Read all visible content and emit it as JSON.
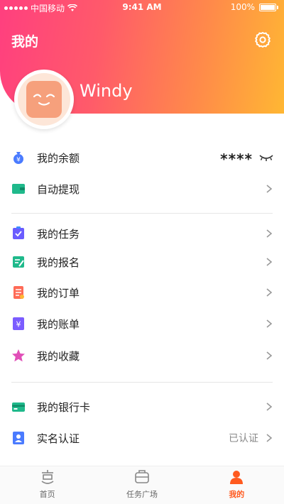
{
  "status_bar": {
    "carrier": "中国移动",
    "time": "9:41 AM",
    "battery": "100%"
  },
  "header": {
    "title": "我的",
    "settings_icon": "gear-icon",
    "gradient_colors": [
      "#ff3f7f",
      "#ff8a4a",
      "#ffb733"
    ]
  },
  "profile": {
    "username": "Windy"
  },
  "menu": {
    "balance": {
      "label": "我的余额",
      "value": "****",
      "icon": "money-bag-icon",
      "toggle_icon": "eye-closed-icon"
    },
    "auto_withdraw": {
      "label": "自动提现",
      "icon": "wallet-icon"
    },
    "tasks": {
      "label": "我的任务",
      "icon": "task-icon"
    },
    "signups": {
      "label": "我的报名",
      "icon": "signup-icon"
    },
    "orders": {
      "label": "我的订单",
      "icon": "order-icon"
    },
    "bills": {
      "label": "我的账单",
      "icon": "bill-icon"
    },
    "favorites": {
      "label": "我的收藏",
      "icon": "star-icon"
    },
    "bank_card": {
      "label": "我的银行卡",
      "icon": "bank-card-icon"
    },
    "real_name": {
      "label": "实名认证",
      "status": "已认证",
      "icon": "id-card-icon"
    }
  },
  "tab_bar": {
    "tabs": [
      {
        "label": "首页",
        "icon": "home-icon"
      },
      {
        "label": "任务广场",
        "icon": "task-square-icon"
      },
      {
        "label": "我的",
        "icon": "profile-icon"
      }
    ],
    "active_color": "#ff5a1f"
  }
}
